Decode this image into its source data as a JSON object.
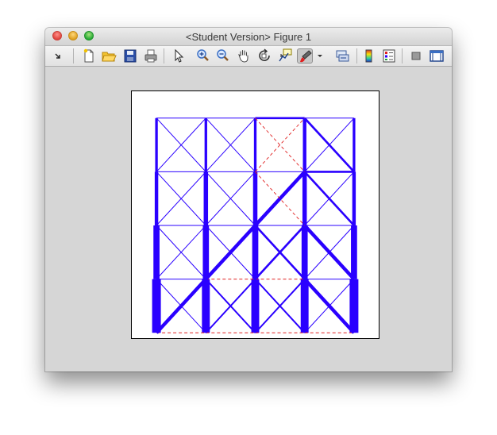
{
  "window": {
    "title": "<Student Version> Figure 1"
  },
  "toolbar": {
    "items": [
      {
        "name": "dock-arrow-icon",
        "tooltip": "Dock"
      },
      {
        "name": "new-figure-icon",
        "tooltip": "New Figure"
      },
      {
        "name": "open-file-icon",
        "tooltip": "Open File"
      },
      {
        "name": "save-figure-icon",
        "tooltip": "Save Figure"
      },
      {
        "name": "print-figure-icon",
        "tooltip": "Print Figure"
      },
      {
        "name": "edit-plot-icon",
        "tooltip": "Edit Plot"
      },
      {
        "name": "zoom-in-icon",
        "tooltip": "Zoom In"
      },
      {
        "name": "zoom-out-icon",
        "tooltip": "Zoom Out"
      },
      {
        "name": "pan-icon",
        "tooltip": "Pan"
      },
      {
        "name": "rotate-3d-icon",
        "tooltip": "Rotate 3D"
      },
      {
        "name": "data-cursor-icon",
        "tooltip": "Data Cursor"
      },
      {
        "name": "brush-icon",
        "tooltip": "Brush/Select Data"
      },
      {
        "name": "brush-menu-chevron-icon",
        "tooltip": ""
      },
      {
        "name": "link-plot-icon",
        "tooltip": "Link Plot"
      },
      {
        "name": "insert-colorbar-icon",
        "tooltip": "Insert Colorbar"
      },
      {
        "name": "insert-legend-icon",
        "tooltip": "Insert Legend"
      },
      {
        "name": "hide-plot-tools-icon",
        "tooltip": "Hide Plot Tools"
      },
      {
        "name": "show-plot-tools-icon",
        "tooltip": "Show Plot Tools and Dock Figure"
      }
    ]
  },
  "colors": {
    "member": "#2a00ff",
    "dashed_member": "#e02020",
    "axes_background": "#ffffff",
    "figure_background": "#d6d6d6"
  },
  "chart_data": {
    "type": "line",
    "title": "",
    "xlabel": "",
    "ylabel": "",
    "xlim": [
      -0.5,
      4.5
    ],
    "ylim": [
      -0.1,
      4.5
    ],
    "grid": false,
    "ticks": false,
    "nodes": {
      "x": [
        0,
        1,
        2,
        3,
        4
      ],
      "y": [
        0,
        1,
        2,
        3,
        4
      ]
    },
    "members": [
      {
        "x": [
          0,
          0
        ],
        "y": [
          0,
          1
        ],
        "style": "solid",
        "weight": 5
      },
      {
        "x": [
          0,
          0
        ],
        "y": [
          1,
          2
        ],
        "style": "solid",
        "weight": 3.5
      },
      {
        "x": [
          0,
          0
        ],
        "y": [
          2,
          3
        ],
        "style": "solid",
        "weight": 2
      },
      {
        "x": [
          0,
          0
        ],
        "y": [
          3,
          4
        ],
        "style": "solid",
        "weight": 1.5
      },
      {
        "x": [
          1,
          1
        ],
        "y": [
          0,
          1
        ],
        "style": "solid",
        "weight": 4.5
      },
      {
        "x": [
          1,
          1
        ],
        "y": [
          1,
          2
        ],
        "style": "solid",
        "weight": 3.5
      },
      {
        "x": [
          1,
          1
        ],
        "y": [
          2,
          3
        ],
        "style": "solid",
        "weight": 2.5
      },
      {
        "x": [
          1,
          1
        ],
        "y": [
          3,
          4
        ],
        "style": "solid",
        "weight": 1.5
      },
      {
        "x": [
          2,
          2
        ],
        "y": [
          0,
          1
        ],
        "style": "solid",
        "weight": 4.5
      },
      {
        "x": [
          2,
          2
        ],
        "y": [
          1,
          2
        ],
        "style": "solid",
        "weight": 3.5
      },
      {
        "x": [
          2,
          2
        ],
        "y": [
          2,
          3
        ],
        "style": "solid",
        "weight": 2.5
      },
      {
        "x": [
          2,
          2
        ],
        "y": [
          3,
          4
        ],
        "style": "solid",
        "weight": 1.5
      },
      {
        "x": [
          3,
          3
        ],
        "y": [
          0,
          1
        ],
        "style": "solid",
        "weight": 4.5
      },
      {
        "x": [
          3,
          3
        ],
        "y": [
          1,
          2
        ],
        "style": "solid",
        "weight": 3.5
      },
      {
        "x": [
          3,
          3
        ],
        "y": [
          2,
          3
        ],
        "style": "solid",
        "weight": 2.5
      },
      {
        "x": [
          3,
          3
        ],
        "y": [
          3,
          4
        ],
        "style": "solid",
        "weight": 2
      },
      {
        "x": [
          4,
          4
        ],
        "y": [
          0,
          1
        ],
        "style": "solid",
        "weight": 5
      },
      {
        "x": [
          4,
          4
        ],
        "y": [
          1,
          2
        ],
        "style": "solid",
        "weight": 3.5
      },
      {
        "x": [
          4,
          4
        ],
        "y": [
          2,
          3
        ],
        "style": "solid",
        "weight": 2
      },
      {
        "x": [
          4,
          4
        ],
        "y": [
          3,
          4
        ],
        "style": "solid",
        "weight": 1.5
      },
      {
        "x": [
          0,
          1
        ],
        "y": [
          0,
          0
        ],
        "style": "dashed",
        "weight": 0.4
      },
      {
        "x": [
          1,
          2
        ],
        "y": [
          0,
          0
        ],
        "style": "dashed",
        "weight": 0.4
      },
      {
        "x": [
          2,
          3
        ],
        "y": [
          0,
          0
        ],
        "style": "dashed",
        "weight": 0.4
      },
      {
        "x": [
          3,
          4
        ],
        "y": [
          0,
          0
        ],
        "style": "dashed",
        "weight": 0.4
      },
      {
        "x": [
          0,
          1
        ],
        "y": [
          1,
          1
        ],
        "style": "solid",
        "weight": 0.5
      },
      {
        "x": [
          1,
          2
        ],
        "y": [
          1,
          1
        ],
        "style": "dashed",
        "weight": 0.4
      },
      {
        "x": [
          2,
          3
        ],
        "y": [
          1,
          1
        ],
        "style": "dashed",
        "weight": 0.4
      },
      {
        "x": [
          3,
          4
        ],
        "y": [
          1,
          1
        ],
        "style": "solid",
        "weight": 0.5
      },
      {
        "x": [
          0,
          1
        ],
        "y": [
          2,
          2
        ],
        "style": "solid",
        "weight": 0.5
      },
      {
        "x": [
          1,
          2
        ],
        "y": [
          2,
          2
        ],
        "style": "solid",
        "weight": 0.5
      },
      {
        "x": [
          2,
          3
        ],
        "y": [
          2,
          2
        ],
        "style": "solid",
        "weight": 0.5
      },
      {
        "x": [
          3,
          4
        ],
        "y": [
          2,
          2
        ],
        "style": "solid",
        "weight": 0.5
      },
      {
        "x": [
          0,
          1
        ],
        "y": [
          3,
          3
        ],
        "style": "solid",
        "weight": 0.5
      },
      {
        "x": [
          1,
          2
        ],
        "y": [
          3,
          3
        ],
        "style": "solid",
        "weight": 0.5
      },
      {
        "x": [
          2,
          3
        ],
        "y": [
          3,
          3
        ],
        "style": "solid",
        "weight": 0.5
      },
      {
        "x": [
          3,
          4
        ],
        "y": [
          3,
          3
        ],
        "style": "solid",
        "weight": 1.2
      },
      {
        "x": [
          0,
          1
        ],
        "y": [
          4,
          4
        ],
        "style": "solid",
        "weight": 0.5
      },
      {
        "x": [
          1,
          2
        ],
        "y": [
          4,
          4
        ],
        "style": "solid",
        "weight": 0.5
      },
      {
        "x": [
          2,
          3
        ],
        "y": [
          4,
          4
        ],
        "style": "solid",
        "weight": 1.2
      },
      {
        "x": [
          3,
          4
        ],
        "y": [
          4,
          4
        ],
        "style": "solid",
        "weight": 0.5
      },
      {
        "x": [
          0,
          1
        ],
        "y": [
          0,
          1
        ],
        "style": "solid",
        "weight": 2
      },
      {
        "x": [
          0,
          1
        ],
        "y": [
          1,
          0
        ],
        "style": "solid",
        "weight": 0.5
      },
      {
        "x": [
          1,
          2
        ],
        "y": [
          0,
          1
        ],
        "style": "solid",
        "weight": 1
      },
      {
        "x": [
          1,
          2
        ],
        "y": [
          1,
          0
        ],
        "style": "solid",
        "weight": 1
      },
      {
        "x": [
          2,
          3
        ],
        "y": [
          0,
          1
        ],
        "style": "solid",
        "weight": 1
      },
      {
        "x": [
          2,
          3
        ],
        "y": [
          1,
          0
        ],
        "style": "solid",
        "weight": 1
      },
      {
        "x": [
          3,
          4
        ],
        "y": [
          0,
          1
        ],
        "style": "solid",
        "weight": 0.5
      },
      {
        "x": [
          3,
          4
        ],
        "y": [
          1,
          0
        ],
        "style": "solid",
        "weight": 2
      },
      {
        "x": [
          0,
          1
        ],
        "y": [
          1,
          2
        ],
        "style": "solid",
        "weight": 0.5
      },
      {
        "x": [
          0,
          1
        ],
        "y": [
          2,
          1
        ],
        "style": "solid",
        "weight": 0.5
      },
      {
        "x": [
          1,
          2
        ],
        "y": [
          1,
          2
        ],
        "style": "solid",
        "weight": 2
      },
      {
        "x": [
          1,
          2
        ],
        "y": [
          2,
          1
        ],
        "style": "solid",
        "weight": 0.5
      },
      {
        "x": [
          2,
          3
        ],
        "y": [
          1,
          2
        ],
        "style": "solid",
        "weight": 1.2
      },
      {
        "x": [
          2,
          3
        ],
        "y": [
          2,
          1
        ],
        "style": "solid",
        "weight": 1.2
      },
      {
        "x": [
          3,
          4
        ],
        "y": [
          1,
          2
        ],
        "style": "solid",
        "weight": 0.5
      },
      {
        "x": [
          3,
          4
        ],
        "y": [
          2,
          1
        ],
        "style": "solid",
        "weight": 2
      },
      {
        "x": [
          0,
          1
        ],
        "y": [
          2,
          3
        ],
        "style": "solid",
        "weight": 0.5
      },
      {
        "x": [
          0,
          1
        ],
        "y": [
          3,
          2
        ],
        "style": "solid",
        "weight": 0.5
      },
      {
        "x": [
          1,
          2
        ],
        "y": [
          2,
          3
        ],
        "style": "solid",
        "weight": 0.5
      },
      {
        "x": [
          1,
          2
        ],
        "y": [
          3,
          2
        ],
        "style": "solid",
        "weight": 0.5
      },
      {
        "x": [
          2,
          3
        ],
        "y": [
          2,
          3
        ],
        "style": "solid",
        "weight": 2
      },
      {
        "x": [
          2,
          3
        ],
        "y": [
          3,
          2
        ],
        "style": "dashed",
        "weight": 0.4
      },
      {
        "x": [
          3,
          4
        ],
        "y": [
          2,
          3
        ],
        "style": "solid",
        "weight": 0.5
      },
      {
        "x": [
          3,
          4
        ],
        "y": [
          3,
          2
        ],
        "style": "solid",
        "weight": 1.2
      },
      {
        "x": [
          0,
          1
        ],
        "y": [
          3,
          4
        ],
        "style": "solid",
        "weight": 0.5
      },
      {
        "x": [
          0,
          1
        ],
        "y": [
          4,
          3
        ],
        "style": "solid",
        "weight": 0.5
      },
      {
        "x": [
          1,
          2
        ],
        "y": [
          3,
          4
        ],
        "style": "solid",
        "weight": 0.5
      },
      {
        "x": [
          1,
          2
        ],
        "y": [
          4,
          3
        ],
        "style": "solid",
        "weight": 0.5
      },
      {
        "x": [
          2,
          3
        ],
        "y": [
          3,
          4
        ],
        "style": "dashed",
        "weight": 0.4
      },
      {
        "x": [
          2,
          3
        ],
        "y": [
          4,
          3
        ],
        "style": "dashed",
        "weight": 0.4
      },
      {
        "x": [
          3,
          4
        ],
        "y": [
          3,
          4
        ],
        "style": "solid",
        "weight": 0.5
      },
      {
        "x": [
          3,
          4
        ],
        "y": [
          4,
          3
        ],
        "style": "solid",
        "weight": 1.2
      }
    ]
  }
}
